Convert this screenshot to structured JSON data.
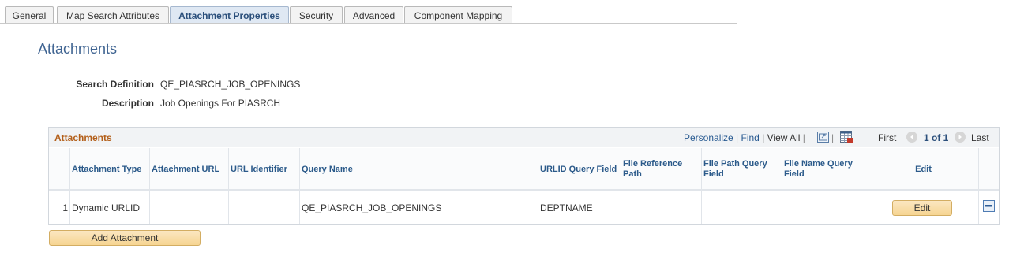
{
  "tabs": [
    {
      "label": "General",
      "active": false
    },
    {
      "label": "Map Search Attributes",
      "active": false
    },
    {
      "label": "Attachment Properties",
      "active": true
    },
    {
      "label": "Security",
      "active": false
    },
    {
      "label": "Advanced",
      "active": false
    },
    {
      "label": "Component Mapping",
      "active": false
    }
  ],
  "page_title": "Attachments",
  "fields": {
    "search_definition": {
      "label": "Search Definition",
      "value": "QE_PIASRCH_JOB_OPENINGS"
    },
    "description": {
      "label": "Description",
      "value": "Job Openings For PIASRCH"
    }
  },
  "grid": {
    "title": "Attachments",
    "personalize": "Personalize",
    "find": "Find",
    "view_all": "View All",
    "first": "First",
    "range": "1 of 1",
    "last": "Last",
    "columns": [
      "",
      "Attachment Type",
      "Attachment URL",
      "URL Identifier",
      "Query Name",
      "URLID Query Field",
      "File Reference Path",
      "File Path Query Field",
      "File Name Query Field",
      "Edit",
      ""
    ],
    "rows": [
      {
        "num": "1",
        "attachment_type": "Dynamic URLID",
        "attachment_url": "",
        "url_identifier": "",
        "query_name": "QE_PIASRCH_JOB_OPENINGS",
        "urlid_query_field": "DEPTNAME",
        "file_reference_path": "",
        "file_path_query_field": "",
        "file_name_query_field": "",
        "edit_label": "Edit"
      }
    ]
  },
  "add_attachment_label": "Add Attachment",
  "colors": {
    "accent": "#3e6391",
    "grid_title": "#b35f1a",
    "button": "#f6d592"
  },
  "icons": [
    "zoom-icon",
    "download-grid-icon",
    "previous-circle-icon",
    "next-circle-icon",
    "delete-row-icon"
  ]
}
